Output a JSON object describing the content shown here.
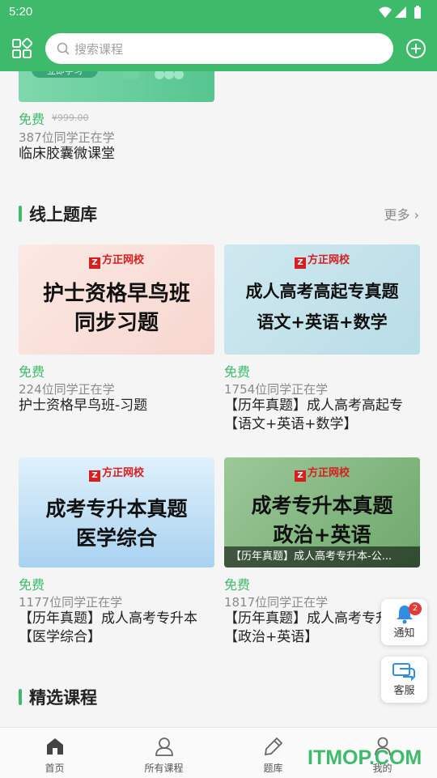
{
  "status": {
    "time": "5:20"
  },
  "search": {
    "placeholder": "搜索课程"
  },
  "top_course": {
    "banner_text": "立即学习",
    "price": "免费",
    "original_price": "¥999.00",
    "learners": "387位同学正在学",
    "title": "临床胶囊微课堂"
  },
  "section_question_bank": {
    "title": "线上题库",
    "more": "更多"
  },
  "cards": [
    {
      "brand": "方正网校",
      "line1": "护士资格早鸟班",
      "line2": "同步习题",
      "strip": "",
      "price": "免费",
      "learners": "224位同学正在学",
      "title": "护士资格早鸟班-习题"
    },
    {
      "brand": "方正网校",
      "line1": "成人高考高起专真题",
      "line2": "语文+英语+数学",
      "strip": "",
      "price": "免费",
      "learners": "1754位同学正在学",
      "title": "【历年真题】成人高考高起专【语文+英语+数学】"
    },
    {
      "brand": "方正网校",
      "line1": "成考专升本真题",
      "line2": "医学综合",
      "strip": "",
      "price": "免费",
      "learners": "1177位同学正在学",
      "title": "【历年真题】成人高考专升本【医学综合】"
    },
    {
      "brand": "方正网校",
      "line1": "成考专升本真题",
      "line2": "政治+英语",
      "strip": "【历年真题】成人高考专升本-公...",
      "price": "免费",
      "learners": "1817位同学正在学",
      "title": "【历年真题】成人高考专升本【政治+英语】"
    }
  ],
  "section_featured": {
    "title": "精选课程"
  },
  "float": {
    "notify_label": "通知",
    "notify_badge": "2",
    "service_label": "客服"
  },
  "tabs": [
    {
      "label": "首页",
      "icon": "home-icon",
      "active": true
    },
    {
      "label": "所有课程",
      "icon": "courses-icon"
    },
    {
      "label": "题库",
      "icon": "pencil-icon"
    },
    {
      "label": "我的",
      "icon": "profile-icon"
    }
  ],
  "watermark": "ITMOP.COM",
  "colors": {
    "accent": "#3dbb6b",
    "price": "#3dbb6b",
    "badge": "#e53935",
    "brand": "#d61f1f"
  }
}
